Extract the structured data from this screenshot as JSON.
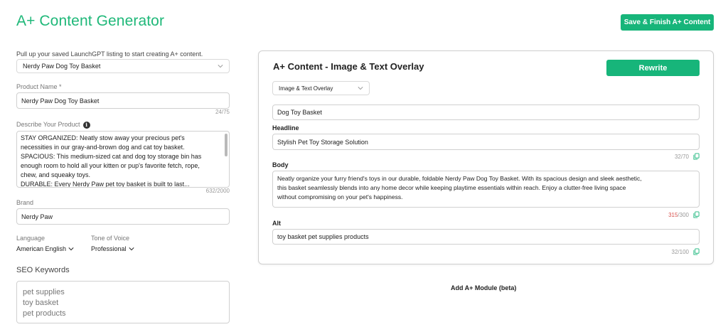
{
  "header": {
    "title": "A+ Content Generator",
    "finish_button": "Save & Finish A+ Content"
  },
  "left": {
    "instruction": "Pull up your saved LaunchGPT listing to start creating A+ content.",
    "listing_select_value": "Nerdy Paw Dog Toy Basket",
    "product_name_label": "Product Name *",
    "product_name_value": "Nerdy Paw Dog Toy Basket",
    "product_name_counter": "24/75",
    "describe_label": "Describe Your Product",
    "describe_lines": [
      "STAY ORGANIZED: Neatly stow away your precious pet's",
      "necessities in our gray-and-brown dog and cat toy basket.",
      "SPACIOUS: This medium-sized cat and dog toy storage bin has",
      "enough room to hold all your kitten or pup's favorite fetch, rope,",
      "chew, and squeaky toys.",
      "DURABLE: Every Nerdy Paw pet toy basket is built to last..."
    ],
    "describe_counter": "632/2000",
    "brand_label": "Brand",
    "brand_value": "Nerdy Paw",
    "language_label": "Language",
    "language_value": "American English",
    "tone_label": "Tone of Voice",
    "tone_value": "Professional",
    "seo_title": "SEO Keywords",
    "seo_keywords": [
      "pet supplies",
      "toy basket",
      "pet products"
    ]
  },
  "panel": {
    "title": "A+ Content - Image & Text Overlay",
    "rewrite_button": "Rewrite",
    "module_type": "Image & Text Overlay",
    "image_keyword": "Dog Toy Basket",
    "headline_label": "Headline",
    "headline_value": "Stylish Pet Toy Storage Solution",
    "headline_counter": "32/70",
    "body_label": "Body",
    "body_lines": [
      "Neatly organize your furry friend's toys in our durable, foldable Nerdy Paw Dog Toy Basket. With its spacious design and sleek aesthetic,",
      "this basket seamlessly blends into any home decor while keeping playtime essentials within reach. Enjoy a clutter-free living space",
      "without compromising on your pet's happiness."
    ],
    "body_counter_current": "315",
    "body_counter_max": "/300",
    "alt_label": "Alt",
    "alt_value": "toy basket pet supplies products",
    "alt_counter": "32/100"
  },
  "footer": {
    "add_module": "Add A+ Module (beta)"
  },
  "colors": {
    "brand_green": "#17b57a",
    "title_green": "#1fb879",
    "over_limit_red": "#d9534f"
  }
}
